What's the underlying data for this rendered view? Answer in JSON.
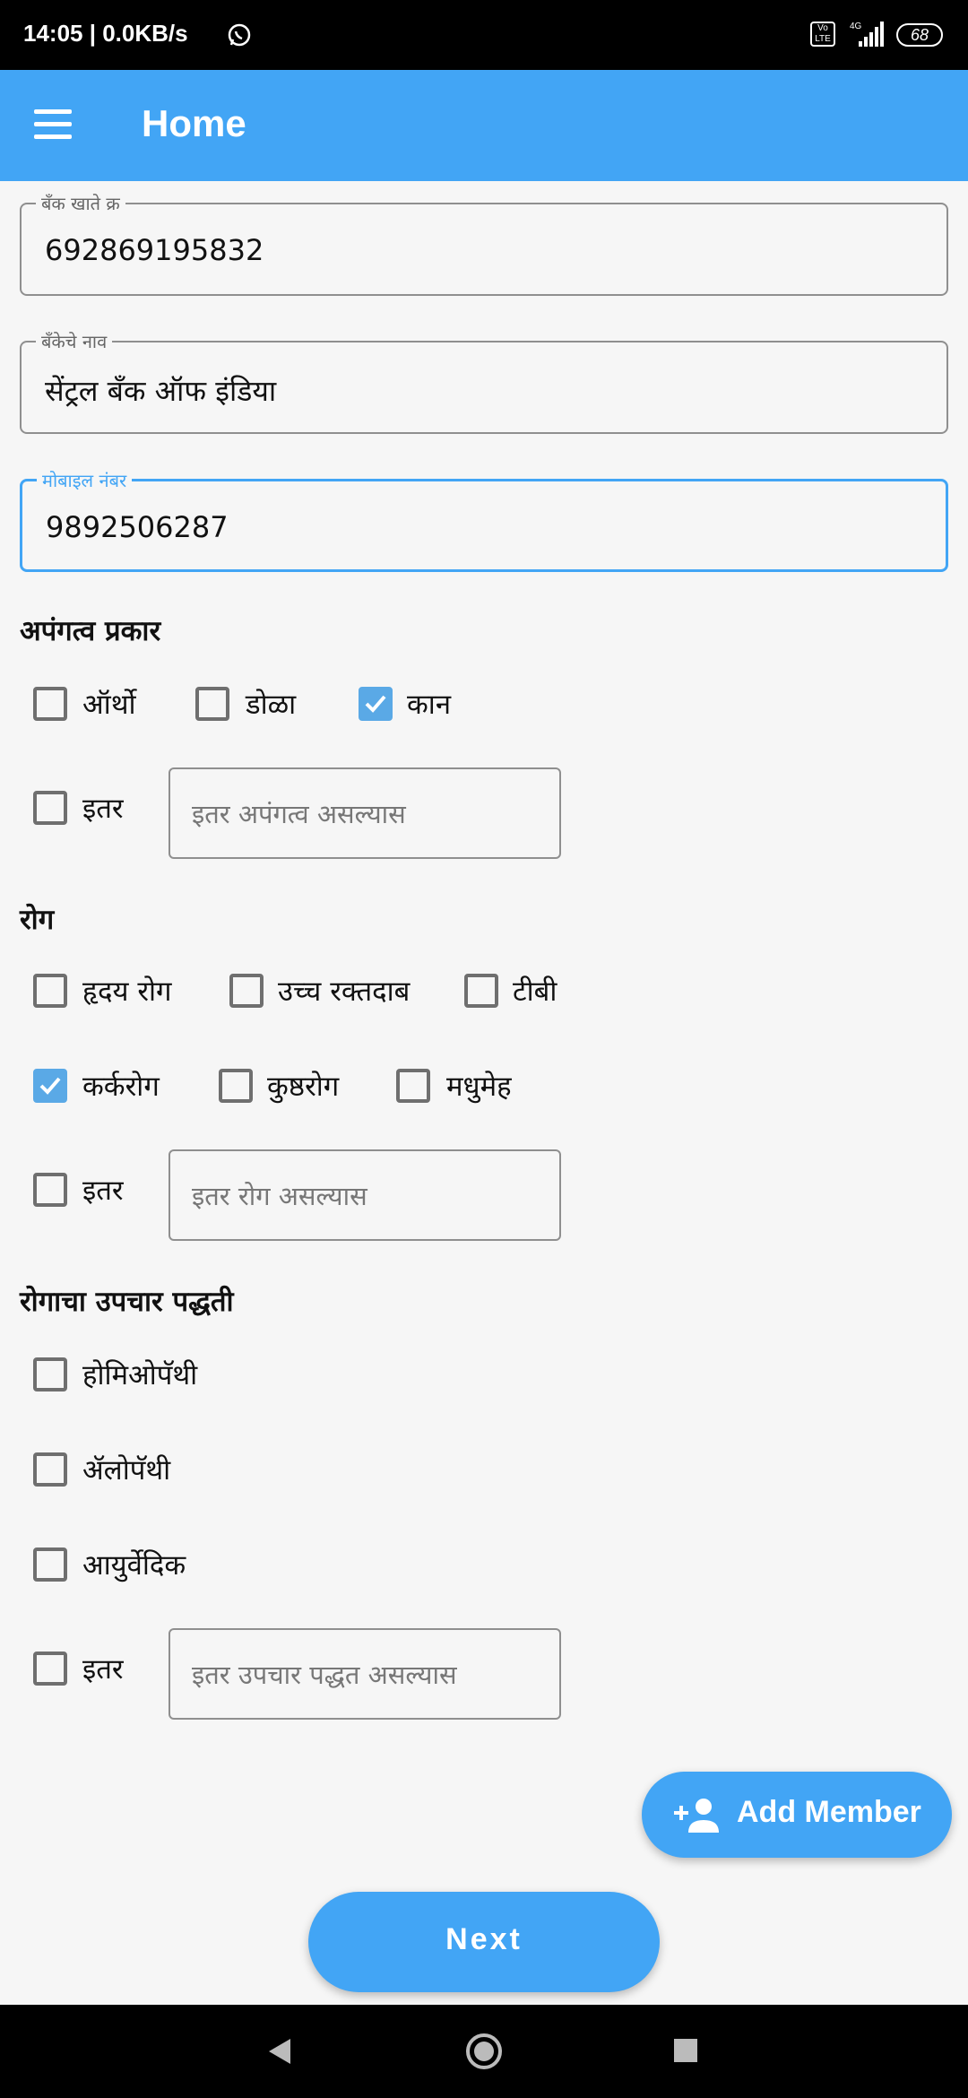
{
  "status_bar": {
    "time": "14:05 | 0.0KB/s",
    "volte": "Vo LTE",
    "battery": "68"
  },
  "app_bar": {
    "title": "Home"
  },
  "fields": {
    "bank_account": {
      "label": "बँक खाते क्र",
      "value": "692869195832"
    },
    "bank_name": {
      "label": "बँकेचे नाव",
      "value": "सेंट्रल बँक ऑफ इंडिया"
    },
    "mobile": {
      "label": "मोबाइल नंबर",
      "value": "9892506287"
    }
  },
  "disability": {
    "heading": "अपंगत्व प्रकार",
    "options": [
      {
        "label": "ऑर्थो",
        "checked": false
      },
      {
        "label": "डोळा",
        "checked": false
      },
      {
        "label": "कान",
        "checked": true
      }
    ],
    "other_label": "इतर",
    "other_checked": false,
    "other_placeholder": "इतर अपंगत्व असल्यास"
  },
  "disease": {
    "heading": "रोग",
    "options": [
      {
        "label": "हृदय रोग",
        "checked": false
      },
      {
        "label": "उच्च रक्तदाब",
        "checked": false
      },
      {
        "label": "टीबी",
        "checked": false
      },
      {
        "label": "कर्करोग",
        "checked": true
      },
      {
        "label": "कुष्ठरोग",
        "checked": false
      },
      {
        "label": "मधुमेह",
        "checked": false
      }
    ],
    "other_label": "इतर",
    "other_checked": false,
    "other_placeholder": "इतर रोग असल्यास"
  },
  "treatment": {
    "heading": "रोगाचा उपचार पद्धती",
    "options": [
      {
        "label": "होमिओपॅथी",
        "checked": false
      },
      {
        "label": "ॲलोपॅथी",
        "checked": false
      },
      {
        "label": "आयुर्वेदिक",
        "checked": false
      }
    ],
    "other_label": "इतर",
    "other_checked": false,
    "other_placeholder": "इतर उपचार पद्धत असल्यास"
  },
  "buttons": {
    "add_member": "Add Member",
    "next": "Next"
  },
  "icons": {
    "menu": "menu-icon",
    "add_member": "person-add-icon",
    "back": "back-icon",
    "home": "home-icon",
    "recent": "recent-apps-icon"
  },
  "colors": {
    "accent": "#42a5f5",
    "checkbox_checked": "#5aa9e6"
  }
}
